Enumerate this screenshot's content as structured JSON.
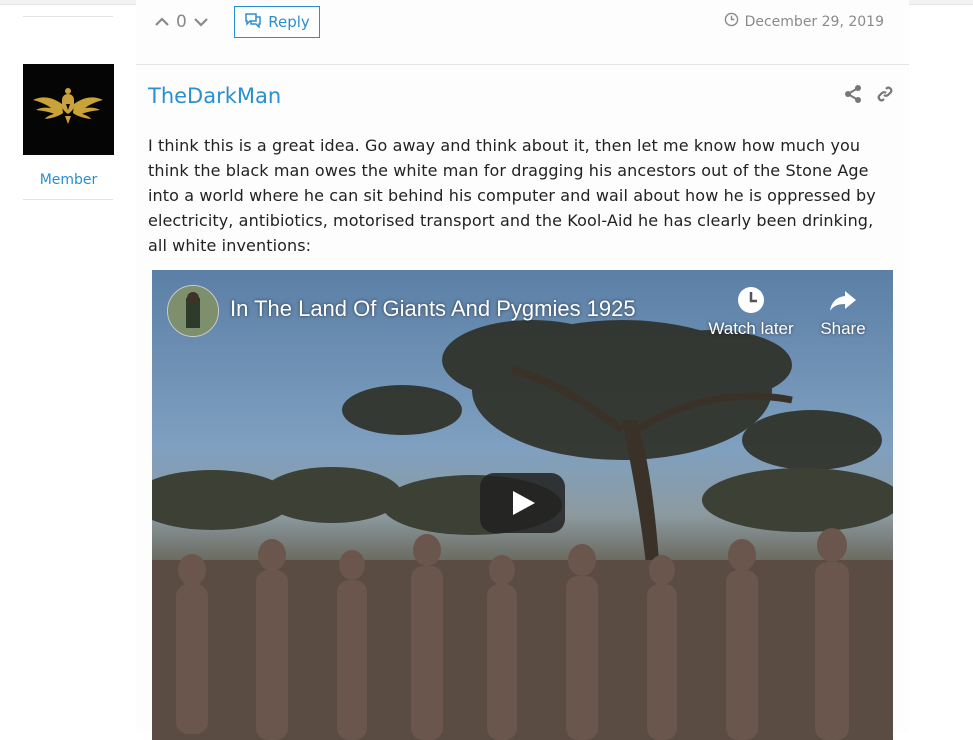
{
  "prev_post": {
    "vote_count": "0",
    "reply_label": "Reply",
    "date": "December 29, 2019"
  },
  "user": {
    "role": "Member"
  },
  "post": {
    "author": "TheDarkMan",
    "body": "I think this is a great idea. Go away and think about it, then let me know how much you think the black man owes the white man for dragging his ancestors out of the Stone Age into a world where he can sit behind his computer and wail about how he is oppressed by electricity, antibiotics, motorised transport and the Kool-Aid he has clearly been drinking, all white inventions:"
  },
  "video": {
    "title": "In The Land Of Giants And Pygmies 1925",
    "watch_later_label": "Watch later",
    "share_label": "Share"
  },
  "icons": {
    "upvote": "chevron-up-icon",
    "downvote": "chevron-down-icon",
    "reply": "comments-icon",
    "clock": "clock-icon",
    "share": "share-icon",
    "link": "link-icon",
    "play": "play-icon"
  },
  "colors": {
    "accent": "#2a8fd0",
    "muted": "#8a8a8a"
  }
}
